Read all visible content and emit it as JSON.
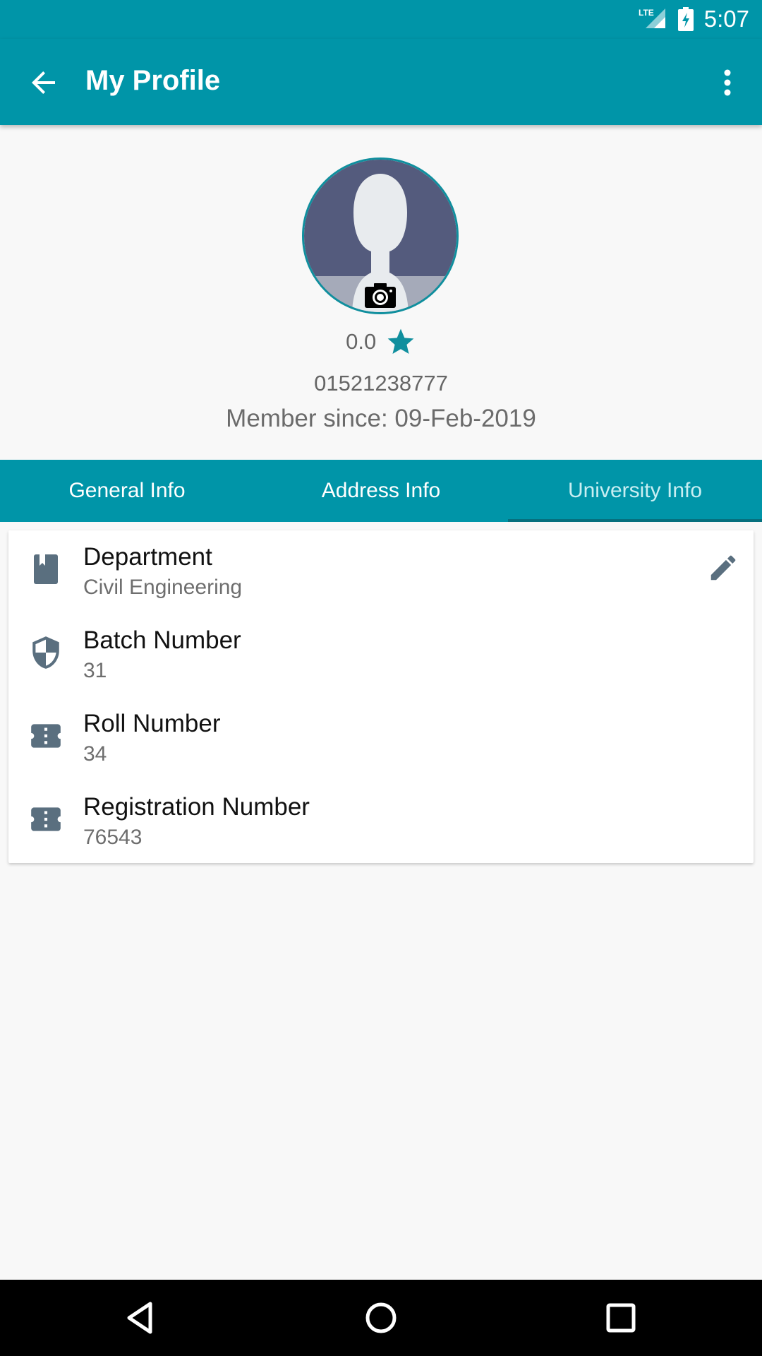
{
  "status_bar": {
    "time": "5:07",
    "network": "LTE"
  },
  "app_bar": {
    "title": "My Profile"
  },
  "profile": {
    "rating": "0.0",
    "phone": "01521238777",
    "member_since": "Member since: 09-Feb-2019"
  },
  "tabs": [
    {
      "label": "General Info",
      "active": false
    },
    {
      "label": "Address Info",
      "active": false
    },
    {
      "label": "University Info",
      "active": true
    }
  ],
  "fields": [
    {
      "label": "Department",
      "value": "Civil Engineering",
      "icon": "book-icon"
    },
    {
      "label": "Batch Number",
      "value": "31",
      "icon": "shield-icon"
    },
    {
      "label": "Roll Number",
      "value": "34",
      "icon": "ticket-icon"
    },
    {
      "label": "Registration Number",
      "value": "76543",
      "icon": "ticket-icon"
    }
  ],
  "colors": {
    "primary": "#0095a8",
    "icon_gray": "#5a6f7f",
    "star": "#108f9e"
  }
}
